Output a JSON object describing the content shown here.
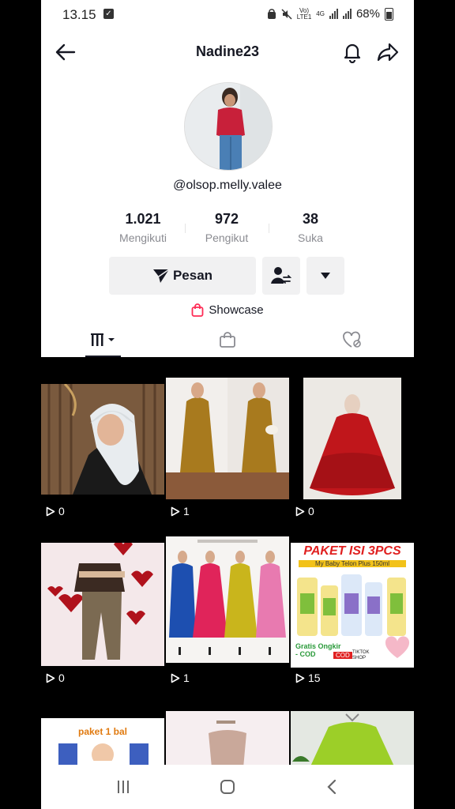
{
  "status_bar": {
    "time": "13.15",
    "network_top": "Vo)",
    "network_bottom": "LTE1",
    "gen": "4G",
    "battery": "68%"
  },
  "header": {
    "title": "Nadine23"
  },
  "profile": {
    "username": "@olsop.melly.valee",
    "stats": [
      {
        "value": "1.021",
        "label": "Mengikuti"
      },
      {
        "value": "972",
        "label": "Pengikut"
      },
      {
        "value": "38",
        "label": "Suka"
      }
    ],
    "message_label": "Pesan",
    "showcase_label": "Showcase"
  },
  "videos": [
    {
      "views": "0"
    },
    {
      "views": "1"
    },
    {
      "views": "0"
    },
    {
      "views": "0"
    },
    {
      "views": "1"
    },
    {
      "views": "15"
    }
  ],
  "captions": {
    "paket_title": "PAKET ISI 3PCS",
    "paket_sub": "My Baby Telon Plus 150ml",
    "brand": "MY BABY",
    "ongkir": "Gratis Ongkir - COD",
    "cod": "COD",
    "tiktok": "TIKTOK SHOP",
    "paket_bal": "paket 1 bal"
  },
  "colors": {
    "accent": "#fe2c55",
    "text": "#161823",
    "muted": "#8a8b91"
  }
}
